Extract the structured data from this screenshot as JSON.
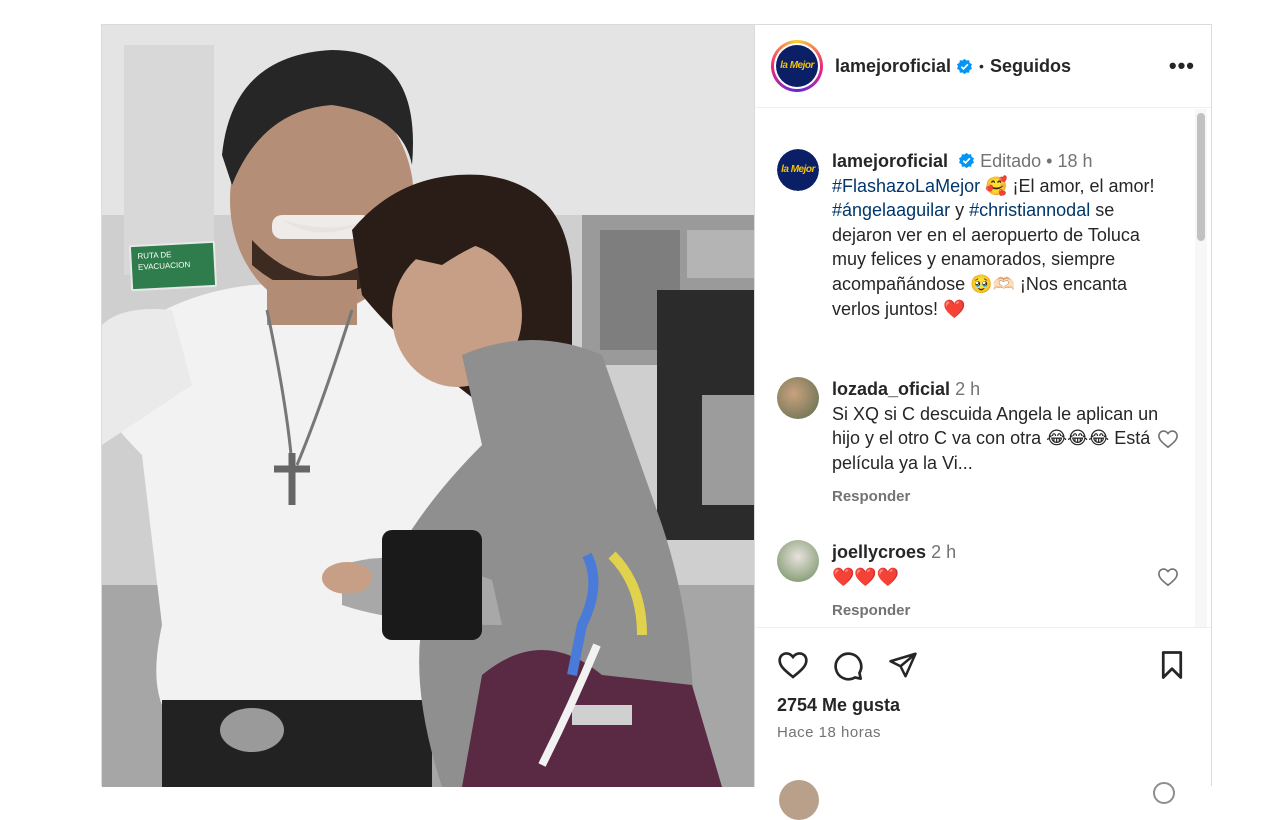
{
  "header": {
    "username": "lamejoroficial",
    "separator": "•",
    "follow_status": "Seguidos",
    "more_label": "•••",
    "logo_text": "la Mejor"
  },
  "caption": {
    "username": "lamejoroficial",
    "edited": "Editado",
    "separator": "•",
    "time": "18 h",
    "text_parts": [
      "#FlashazoLaMejor",
      " 🥰 ¡El amor, el amor! ",
      "#ángelaaguilar",
      " y ",
      "#christiannodal",
      " se dejaron ver en el aeropuerto de Toluca muy felices y enamorados, siempre acompañándose 🥹🫶🏻 ¡Nos encanta verlos juntos! ❤️"
    ]
  },
  "comments": [
    {
      "username": "lozada_oficial",
      "time": "2 h",
      "text": "Si XQ si C descuida Angela le aplican un hijo y el otro C va con otra 😂😂😂 Está película ya la Vi...",
      "reply_label": "Responder"
    },
    {
      "username": "joellycroes",
      "time": "2 h",
      "text": "❤️❤️❤️",
      "reply_label": "Responder"
    }
  ],
  "actions": {
    "likes": "2754 Me gusta",
    "posted": "Hace 18 horas"
  },
  "photo": {
    "sign_line1": "RUTA DE",
    "sign_line2": "EVACUACION"
  },
  "colors": {
    "hashtag": "#00376b",
    "verified": "#0095f6",
    "muted": "#737373",
    "text": "#262626"
  },
  "icons": [
    "verified-badge-icon",
    "more-options-icon",
    "heart-icon",
    "comment-icon",
    "share-icon",
    "save-icon"
  ]
}
